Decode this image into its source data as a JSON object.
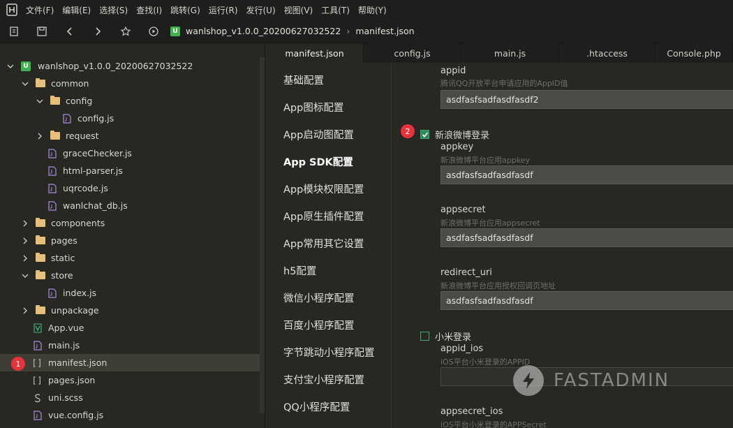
{
  "menu": [
    "文件(F)",
    "编辑(E)",
    "选择(S)",
    "查找(I)",
    "跳转(G)",
    "运行(R)",
    "发行(U)",
    "视图(V)",
    "工具(T)",
    "帮助(Y)"
  ],
  "breadcrumb": {
    "project": "wanlshop_v1.0.0_20200627032522",
    "file": "manifest.json"
  },
  "tree": {
    "root": "wanlshop_v1.0.0_20200627032522",
    "common": "common",
    "config": "config",
    "config_js": "config.js",
    "request": "request",
    "gracechecker": "graceChecker.js",
    "htmlparser": "html-parser.js",
    "uqrcode": "uqrcode.js",
    "wanlchat": "wanlchat_db.js",
    "components": "components",
    "pages": "pages",
    "static": "static",
    "store": "store",
    "index_js": "index.js",
    "unpackage": "unpackage",
    "app_vue": "App.vue",
    "main_js": "main.js",
    "manifest": "manifest.json",
    "pages_json": "pages.json",
    "uni_scss": "uni.scss",
    "vue_config": "vue.config.js"
  },
  "badges": {
    "one": "1",
    "two": "2"
  },
  "tabs": [
    "manifest.json",
    "config.js",
    "main.js",
    ".htaccess",
    "Console.php"
  ],
  "settings_nav": [
    "基础配置",
    "App图标配置",
    "App启动图配置",
    "App SDK配置",
    "App模块权限配置",
    "App原生插件配置",
    "App常用其它设置",
    "h5配置",
    "微信小程序配置",
    "百度小程序配置",
    "字节跳动小程序配置",
    "支付宝小程序配置",
    "QQ小程序配置"
  ],
  "form": {
    "qq_appid_label": "appid",
    "qq_appid_hint": "腾讯QQ开放平台申请应用的AppID值",
    "qq_appid_value": "asdfasfsadfasdfasdf2",
    "weibo_label": "新浪微博登录",
    "weibo_checked": true,
    "appkey_label": "appkey",
    "appkey_hint": "新浪微博平台应用appkey",
    "appkey_value": "asdfasfsadfasdfasdf",
    "appsecret_label": "appsecret",
    "appsecret_hint": "新浪微博平台应用appsecret",
    "appsecret_value": "asdfasfsadfasdfasdf",
    "redirect_label": "redirect_uri",
    "redirect_hint": "新浪微博平台应用授权回调页地址",
    "redirect_value": "asdfasfsadfasdfasdf",
    "xiaomi_label": "小米登录",
    "xiaomi_checked": false,
    "appid_ios_label": "appid_ios",
    "appid_ios_hint": "iOS平台小米登录的APPID",
    "appid_ios_value": "",
    "appsecret_ios_label": "appsecret_ios",
    "appsecret_ios_hint": "iOS平台小米登录的APPSecret"
  },
  "watermark": "FASTADMIN",
  "colors": {
    "accent_green": "#3fb34f",
    "badge_red": "#e8323b",
    "folder": "#e6c07b",
    "file_icon": "#a98ce0"
  }
}
